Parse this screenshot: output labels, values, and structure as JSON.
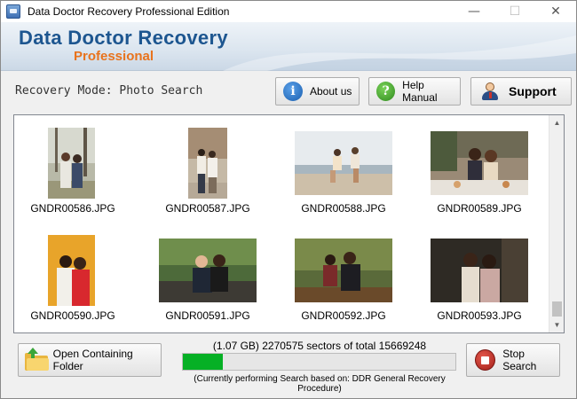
{
  "window": {
    "title": "Data Doctor Recovery Professional Edition",
    "controls": {
      "minimize": "—",
      "maximize": "☐",
      "close": "✕"
    }
  },
  "banner": {
    "title": "Data Doctor Recovery",
    "subtitle": "Professional"
  },
  "toolbar": {
    "mode_label": "Recovery Mode: Photo Search",
    "about_label": "About us",
    "about_icon": "i",
    "help_label": "Help Manual",
    "help_icon": "?",
    "support_label": "Support"
  },
  "gallery": {
    "items": [
      {
        "name": "GNDR00586.JPG",
        "icon": "photo-thumbnail"
      },
      {
        "name": "GNDR00587.JPG",
        "icon": "photo-thumbnail"
      },
      {
        "name": "GNDR00588.JPG",
        "icon": "photo-thumbnail"
      },
      {
        "name": "GNDR00589.JPG",
        "icon": "photo-thumbnail"
      },
      {
        "name": "GNDR00590.JPG",
        "icon": "photo-thumbnail"
      },
      {
        "name": "GNDR00591.JPG",
        "icon": "photo-thumbnail"
      },
      {
        "name": "GNDR00592.JPG",
        "icon": "photo-thumbnail"
      },
      {
        "name": "GNDR00593.JPG",
        "icon": "photo-thumbnail"
      }
    ]
  },
  "footer": {
    "open_folder_label": "Open Containing Folder",
    "stop_label": "Stop Search",
    "sector_status": "(1.07 GB) 2270575  sectors of  total 15669248",
    "progress_fraction": 0.145,
    "search_status": "(Currently performing Search based on:  DDR General Recovery Procedure)",
    "progress_color": "#06b025"
  }
}
